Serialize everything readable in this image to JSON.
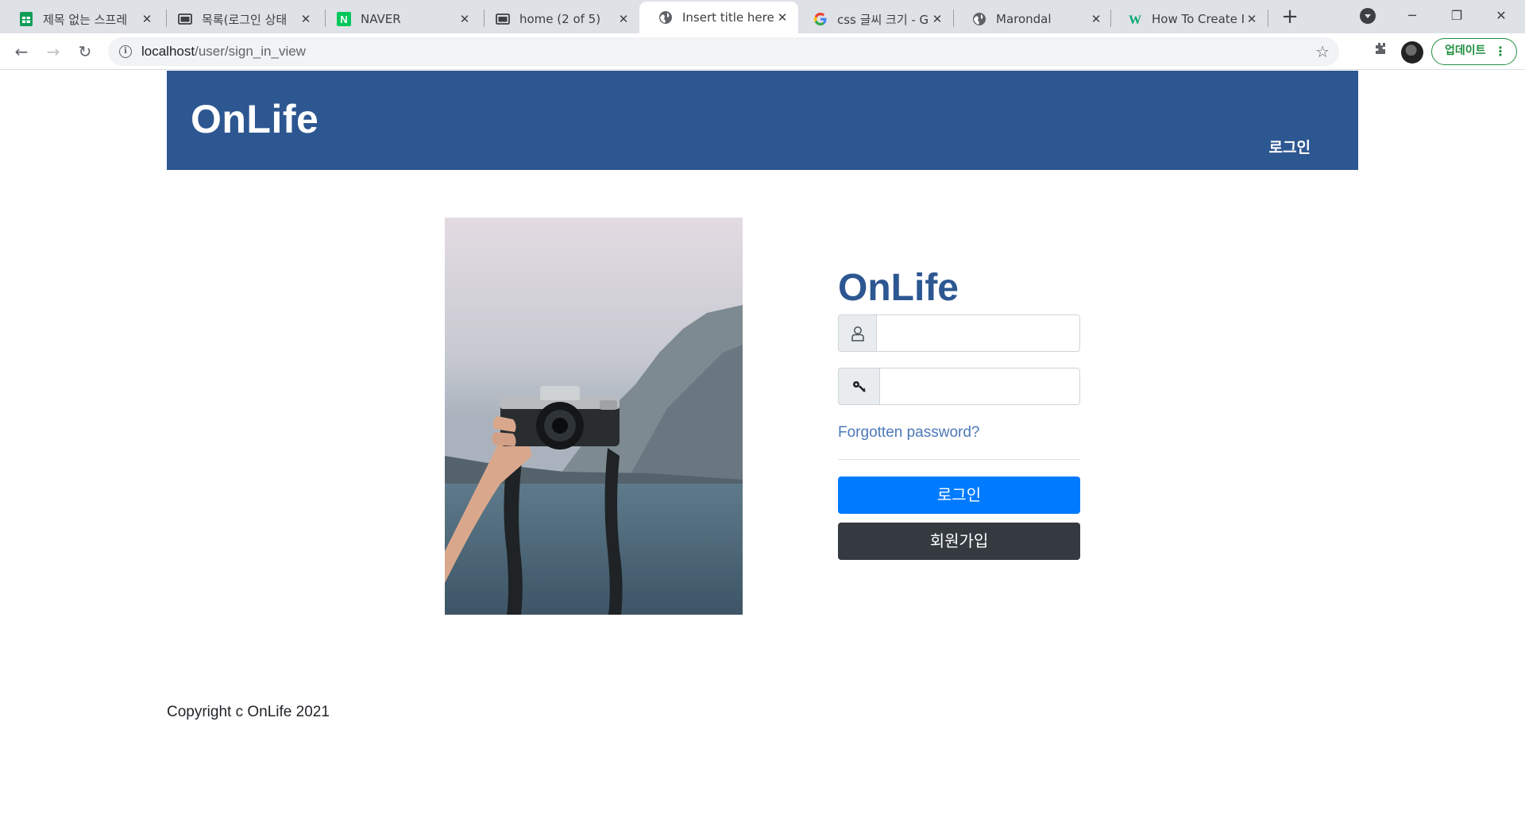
{
  "browser": {
    "tabs": [
      {
        "title": "제목 없는 스프레",
        "icon": "sheets-icon",
        "active": false
      },
      {
        "title": "목록(로그인 상태",
        "icon": "page-icon",
        "active": false
      },
      {
        "title": "NAVER",
        "icon": "naver-icon",
        "active": false
      },
      {
        "title": "home (2 of 5)",
        "icon": "page-icon",
        "active": false
      },
      {
        "title": "Insert title here",
        "icon": "globe-icon",
        "active": true
      },
      {
        "title": "css 글씨 크기 - G",
        "icon": "google-icon",
        "active": false
      },
      {
        "title": "Marondal",
        "icon": "globe-icon",
        "active": false
      },
      {
        "title": "How To Create Ic",
        "icon": "w3schools-icon",
        "active": false
      }
    ],
    "url_host": "localhost",
    "url_path": "/user/sign_in_view",
    "update_label": "업데이트"
  },
  "header": {
    "logo": "OnLife",
    "nav_login": "로그인"
  },
  "login": {
    "title": "OnLife",
    "username_icon": "user-icon",
    "password_icon": "key-icon",
    "username_value": "",
    "password_value": "",
    "forgot_link": "Forgotten password?",
    "login_button": "로그인",
    "signup_button": "회원가입"
  },
  "photo": {
    "subject": "camera-photo"
  },
  "footer": {
    "copyright": "Copyright c OnLife 2021"
  },
  "colors": {
    "header_bg": "#2d5791",
    "primary": "#007bff",
    "dark": "#343a40",
    "link": "#4c78b8",
    "update_green": "#1e8e3e"
  }
}
